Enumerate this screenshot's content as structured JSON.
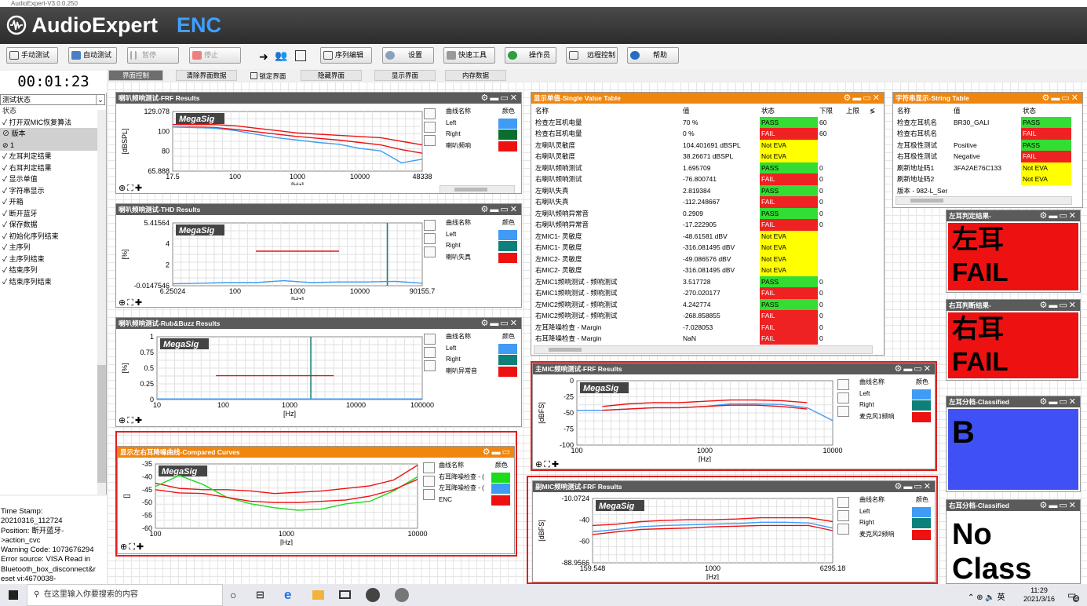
{
  "window": {
    "title": "AudioExpert-V3.0.0.250"
  },
  "brand": {
    "name": "AudioExpert",
    "product": "ENC"
  },
  "toolbar": {
    "buttons": [
      "手动测试",
      "自动测试",
      "暂停",
      "停止",
      "序列编辑",
      "设置",
      "快速工具",
      "操作员",
      "远程控制",
      "帮助"
    ]
  },
  "timer": "00:01:23",
  "tabs": [
    "界面控制",
    "清除界面数据",
    "锁定界面",
    "隐藏界面",
    "显示界面",
    "内存数据"
  ],
  "left": {
    "state_select": "测试状态",
    "header": "状态",
    "items": [
      "✓ 打开双MIC恢复算法",
      "⊘ 版本",
      "⊘ 1",
      "✓ 左耳判定结果",
      "✓ 右耳判定结果",
      "✓ 显示单值",
      "✓ 字符串显示",
      "✓ 开箱",
      "✓ 断开蓝牙",
      "✓ 保存数据",
      "✓ 初始化序列结束",
      "✓ 主序列",
      "✓ 主序列结束",
      "✓ 结束序列",
      "✓ 结束序列结束"
    ],
    "status_lines": [
      "Time Stamp:",
      "20210316_112724",
      "Position: 断开蓝牙-",
      ">action_cvc",
      "Warning Code: 1073676294",
      "Error source: VISA Read in",
      "Bluetooth_box_disconnect&r",
      "eset vi:4670038-"
    ]
  },
  "colors": {
    "blue": "#3f9bf4",
    "green": "#0b6e2e",
    "teal": "#0f7f7a",
    "red": "#ee1111",
    "lime": "#1bdc1b",
    "pass": "#33dd33",
    "fail": "#ee2222",
    "notEva": "#ffff00",
    "classB": "#3f51f5"
  },
  "panels": {
    "frf": {
      "title": "喇叭频响测试-FRF Results",
      "xlabel": "[Hz]",
      "ylabel": "[dBSPL]",
      "yticks": [
        "129.078",
        "100",
        "80",
        "65.888"
      ],
      "xticks": [
        "17.5",
        "100",
        "1000",
        "10000",
        "48338"
      ],
      "legend_header": [
        "曲线名称",
        "颜色"
      ],
      "legend": [
        {
          "name": "Left",
          "color": "#3f9bf4"
        },
        {
          "name": "Right",
          "color": "#0b6e2e"
        },
        {
          "name": "喇叭频响",
          "color": "#ee1111"
        }
      ]
    },
    "thd": {
      "title": "喇叭频响测试-THD Results",
      "xlabel": "[Hz]",
      "ylabel": "[%]",
      "yticks": [
        "5.41564",
        "4",
        "2",
        "-0.0147546"
      ],
      "xticks": [
        "6.25024",
        "100",
        "1000",
        "10000",
        "90155.7"
      ],
      "legend_header": [
        "曲线名称",
        "颜色"
      ],
      "legend": [
        {
          "name": "Left",
          "color": "#3f9bf4"
        },
        {
          "name": "Right",
          "color": "#0f7f7a"
        },
        {
          "name": "喇叭失真",
          "color": "#ee1111"
        }
      ]
    },
    "rub": {
      "title": "喇叭频响测试-Rub&Buzz Results",
      "xlabel": "[Hz]",
      "ylabel": "[%]",
      "yticks": [
        "1",
        "0.75",
        "0.5",
        "0.25",
        "0"
      ],
      "xticks": [
        "10",
        "100",
        "1000",
        "10000",
        "100000"
      ],
      "legend_header": [
        "曲线名称",
        "颜色"
      ],
      "legend": [
        {
          "name": "Left",
          "color": "#3f9bf4"
        },
        {
          "name": "Right",
          "color": "#0f7f7a"
        },
        {
          "name": "喇叭异常音",
          "color": "#ee1111"
        }
      ]
    },
    "cmp": {
      "title": "显示左右耳降噪曲线-Compared Curves",
      "xlabel": "[Hz]",
      "ylabel": "[]",
      "yticks": [
        "-35",
        "-40",
        "-45",
        "-50",
        "-55",
        "-60"
      ],
      "xticks": [
        "100",
        "1000",
        "10000"
      ],
      "legend_header": [
        "曲线名称",
        "颜色"
      ],
      "legend": [
        {
          "name": "右耳降噪检查 - (",
          "color": "#1bdc1b"
        },
        {
          "name": "左耳降噪检查 - (",
          "color": "#3f9bf4"
        },
        {
          "name": "ENC",
          "color": "#ee1111"
        }
      ]
    },
    "mainmic": {
      "title": "主MIC频响测试-FRF Results",
      "xlabel": "[Hz]",
      "ylabel": "[dBFS]",
      "yticks": [
        "0",
        "-25",
        "-50",
        "-75",
        "-100"
      ],
      "xticks": [
        "100",
        "1000",
        "10000"
      ],
      "legend_header": [
        "曲线名称",
        "颜色"
      ],
      "legend": [
        {
          "name": "Left",
          "color": "#3f9bf4"
        },
        {
          "name": "Right",
          "color": "#0f7f7a"
        },
        {
          "name": "麦克风1频响",
          "color": "#ee1111"
        }
      ]
    },
    "submic": {
      "title": "副MIC频响测试-FRF Results",
      "xlabel": "[Hz]",
      "ylabel": "[dBFS]",
      "yticks": [
        "-10.0724",
        "-40",
        "-60",
        "-88.9566"
      ],
      "xticks": [
        "159.548",
        "1000",
        "6295.18"
      ],
      "legend_header": [
        "曲线名称",
        "颜色"
      ],
      "legend": [
        {
          "name": "Left",
          "color": "#3f9bf4"
        },
        {
          "name": "Right",
          "color": "#0f7f7a"
        },
        {
          "name": "麦克风2频响",
          "color": "#ee1111"
        }
      ]
    }
  },
  "svt": {
    "title": "显示单值-Single Value Table",
    "headers": [
      "名称",
      "值",
      "状态",
      "下限",
      "上限",
      "≶"
    ],
    "rows": [
      [
        "检查左耳机电量",
        "70 %",
        "PASS",
        "60",
        ""
      ],
      [
        "检查右耳机电量",
        "0 %",
        "FAIL",
        "60",
        ""
      ],
      [
        "左喇叭灵敏度",
        "104.401691 dBSPL",
        "Not EVA",
        "",
        ""
      ],
      [
        "右喇叭灵敏度",
        "38.26671 dBSPL",
        "Not EVA",
        "",
        ""
      ],
      [
        "左喇叭频响测试",
        "1.695709",
        "PASS",
        "0",
        ""
      ],
      [
        "右喇叭频响测试",
        "-76.800741",
        "FAIL",
        "0",
        ""
      ],
      [
        "左喇叭失真",
        "2.819384",
        "PASS",
        "0",
        ""
      ],
      [
        "右喇叭失真",
        "-112.248667",
        "FAIL",
        "0",
        ""
      ],
      [
        "左喇叭频响异常音",
        "0.2909",
        "PASS",
        "0",
        ""
      ],
      [
        "右喇叭频响异常音",
        "-17.222905",
        "FAIL",
        "0",
        ""
      ],
      [
        "左MIC1- 灵敏度",
        "-48.61581 dBV",
        "Not EVA",
        "",
        ""
      ],
      [
        "右MIC1- 灵敏度",
        "-316.081495 dBV",
        "Not EVA",
        "",
        ""
      ],
      [
        "左MIC2- 灵敏度",
        "-49.086576 dBV",
        "Not EVA",
        "",
        ""
      ],
      [
        "右MIC2- 灵敏度",
        "-316.081495 dBV",
        "Not EVA",
        "",
        ""
      ],
      [
        "左MIC1频响测试 - 频响测试",
        "3.517728",
        "PASS",
        "0",
        ""
      ],
      [
        "右MIC1频响测试 - 频响测试",
        "-270.020177",
        "FAIL",
        "0",
        ""
      ],
      [
        "左MIC2频响测试 - 频响测试",
        "4.242774",
        "PASS",
        "0",
        ""
      ],
      [
        "右MIC2频响测试 - 频响测试",
        "-268.858855",
        "FAIL",
        "0",
        ""
      ],
      [
        "左耳降噪检查 - Margin",
        "-7.028053",
        "FAIL",
        "0",
        ""
      ],
      [
        "右耳降噪检查 - Margin",
        "NaN",
        "FAIL",
        "0",
        ""
      ]
    ]
  },
  "strtable": {
    "title": "字符串显示-String Table",
    "headers": [
      "名称",
      "值",
      "状态"
    ],
    "rows": [
      [
        "检查左耳机名",
        "BR30_GALI",
        "PASS"
      ],
      [
        "检查右耳机名",
        "",
        "FAIL"
      ],
      [
        "左耳极性测试",
        "Positive",
        "PASS"
      ],
      [
        "右耳极性测试",
        "Negative",
        "FAIL"
      ],
      [
        "刷新地址码1",
        "3FA2AE76C133",
        "Not EVA"
      ],
      [
        "刷新地址码2",
        "",
        "Not EVA"
      ],
      [
        "版本 - 982-L_Ser",
        "",
        ""
      ]
    ]
  },
  "results": {
    "left_title": "左耳判定结果-",
    "left_line1": "左耳",
    "left_line2": "FAIL",
    "right_title": "右耳判断结果-",
    "right_line1": "右耳",
    "right_line2": "FAIL",
    "left_class_title": "左耳分档-Classified",
    "left_class": "B",
    "right_class_title": "右耳分档-Classified",
    "right_class_line1": "No",
    "right_class_line2": "Class"
  },
  "taskbar": {
    "search_placeholder": "在这里输入你要搜索的内容",
    "time": "11:29",
    "date": "2021/3/16",
    "lang": "英",
    "notify_count": "4"
  }
}
